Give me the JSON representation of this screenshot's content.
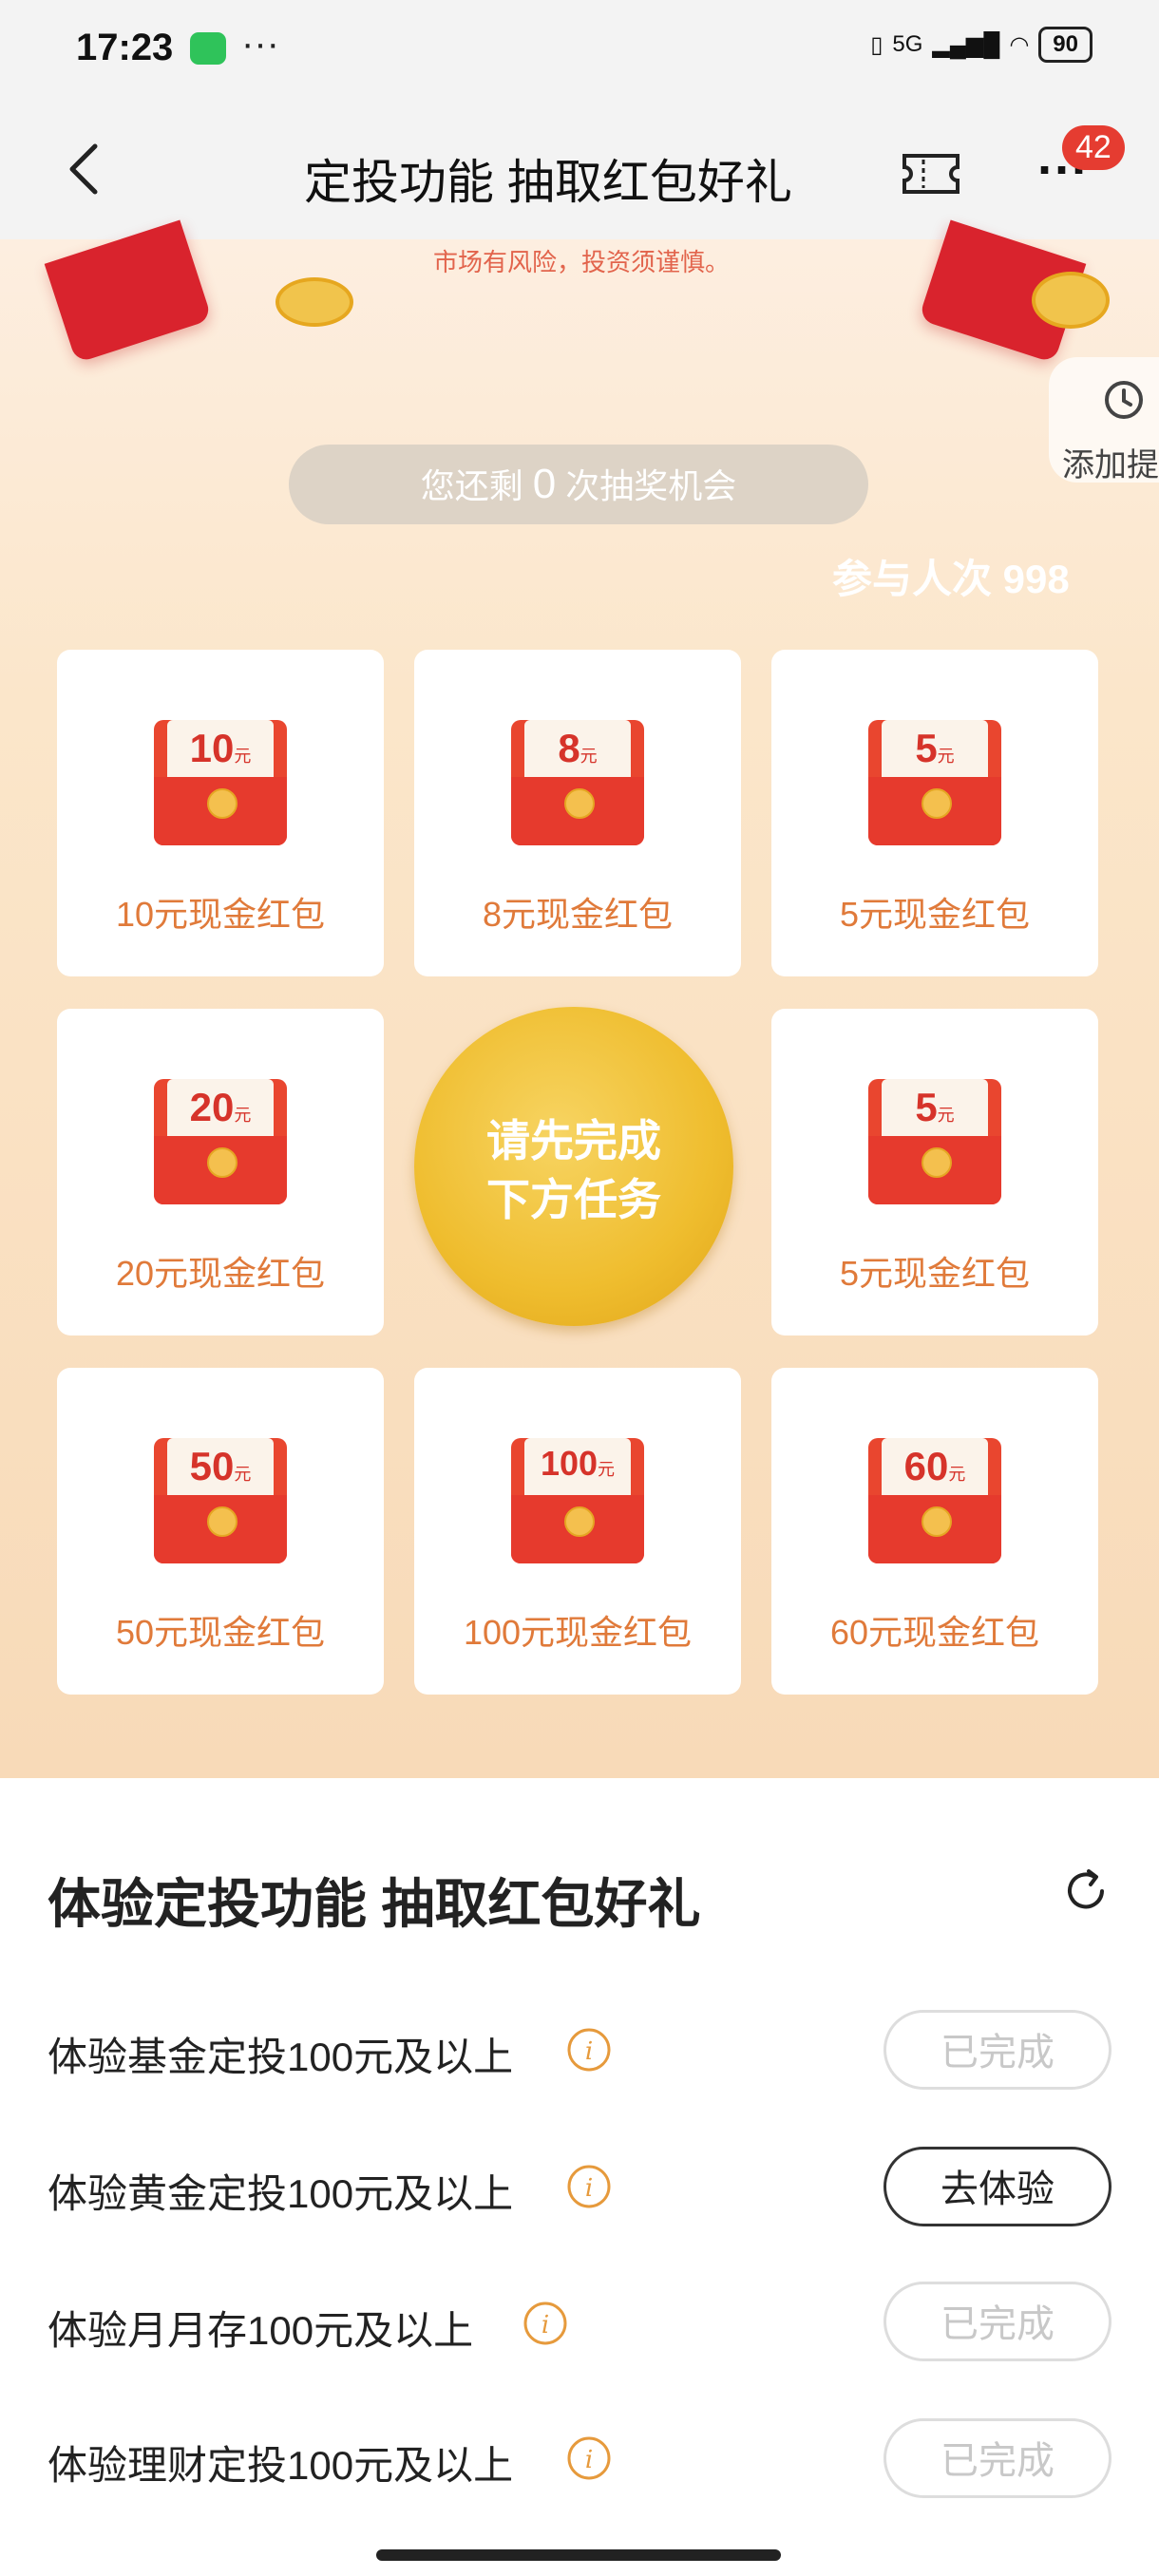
{
  "status_bar": {
    "time": "17:23",
    "more": "···",
    "network": "5G",
    "battery": "90"
  },
  "header": {
    "title": "定投功能 抽取红包好礼",
    "badge_count": "42"
  },
  "hero": {
    "risk_notice": "市场有风险，投资须谨慎。",
    "reminder_label": "添加提",
    "chances_prefix": "您还剩",
    "chances_count": "0",
    "chances_suffix": "次抽奖机会",
    "participants": "参与人次 998"
  },
  "prizes": [
    {
      "amount": "10",
      "unit": "元",
      "label": "10元现金红包"
    },
    {
      "amount": "8",
      "unit": "元",
      "label": "8元现金红包"
    },
    {
      "amount": "5",
      "unit": "元",
      "label": "5元现金红包"
    },
    {
      "amount": "20",
      "unit": "元",
      "label": "20元现金红包"
    },
    {
      "amount": "5",
      "unit": "元",
      "label": "5元现金红包"
    },
    {
      "amount": "50",
      "unit": "元",
      "label": "50元现金红包"
    },
    {
      "amount": "100",
      "unit": "元",
      "label": "100元现金红包"
    },
    {
      "amount": "60",
      "unit": "元",
      "label": "60元现金红包"
    }
  ],
  "center_button": {
    "line1": "请先完成",
    "line2": "下方任务"
  },
  "tasks": {
    "title": "体验定投功能 抽取红包好礼",
    "items": [
      {
        "label": "体验基金定投100元及以上",
        "button": "已完成",
        "status": "done"
      },
      {
        "label": "体验黄金定投100元及以上",
        "button": "去体验",
        "status": "todo"
      },
      {
        "label": "体验月月存100元及以上",
        "button": "已完成",
        "status": "done"
      },
      {
        "label": "体验理财定投100元及以上",
        "button": "已完成",
        "status": "done"
      }
    ]
  },
  "colors": {
    "accent_red": "#e53c31",
    "prize_text": "#e07a3a",
    "gold": "#efbd2e"
  }
}
